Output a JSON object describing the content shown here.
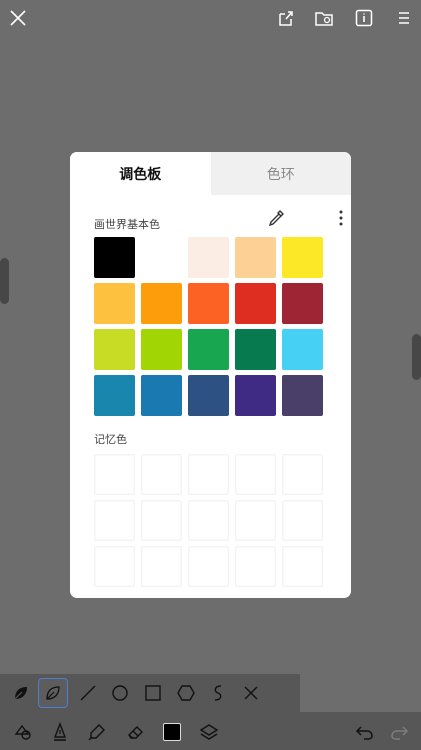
{
  "tabs": [
    {
      "label": "调色板",
      "active": true
    },
    {
      "label": "色环",
      "active": false
    }
  ],
  "palette": {
    "title": "画世界基本色",
    "swatches": [
      "#000000",
      "#ffffff",
      "#fbece4",
      "#fdd095",
      "#fde828",
      "#fdc03f",
      "#fd9d0b",
      "#fc6223",
      "#de2e21",
      "#9d2534",
      "#c9dc25",
      "#a1d504",
      "#18a650",
      "#077a4f",
      "#46d0f4",
      "#1986ad",
      "#1a79b1",
      "#2e5183",
      "#3f2b83",
      "#4a3f68"
    ]
  },
  "memory": {
    "title": "记忆色",
    "slots": 15
  },
  "icons": {
    "top": [
      "close-icon",
      "share-icon",
      "folder-icon",
      "info-icon",
      "menu-icon"
    ],
    "sub": [
      "leaf-brush-icon",
      "freehand-lasso-icon",
      "line-icon",
      "circle-icon",
      "square-icon",
      "hexagon-icon",
      "curve-icon",
      "close-icon"
    ],
    "bottom": [
      "shapes-icon",
      "pen-icon",
      "fill-icon",
      "eraser-icon",
      "color-icon",
      "layers-icon",
      "undo-icon",
      "redo-icon"
    ]
  },
  "colors": {
    "current": "#000000",
    "accent": "#4f7dd0"
  }
}
